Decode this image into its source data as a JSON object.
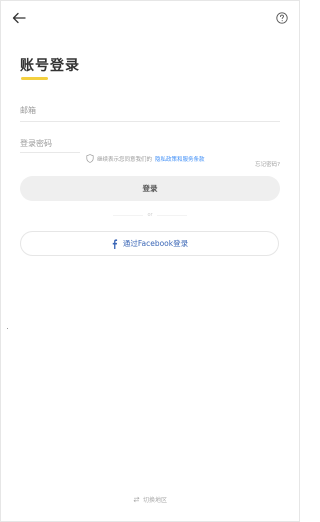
{
  "header": {
    "back_icon": "arrow-left-icon",
    "help_icon": "question-circle-icon"
  },
  "title": {
    "text": "账号登录",
    "accent_color": "#f4d03f"
  },
  "form": {
    "email_label": "邮箱",
    "password_label": "登录密码",
    "agreement_prefix": "继续表示您同意我们的",
    "agreement_links": "隐私政策和服务条款",
    "forgot_password": "忘记密码?",
    "login_button": "登录"
  },
  "divider": {
    "text": "or"
  },
  "facebook": {
    "label": "通过Facebook登录",
    "color": "#3a66b6"
  },
  "footer": {
    "switch_region": "切换地区"
  }
}
